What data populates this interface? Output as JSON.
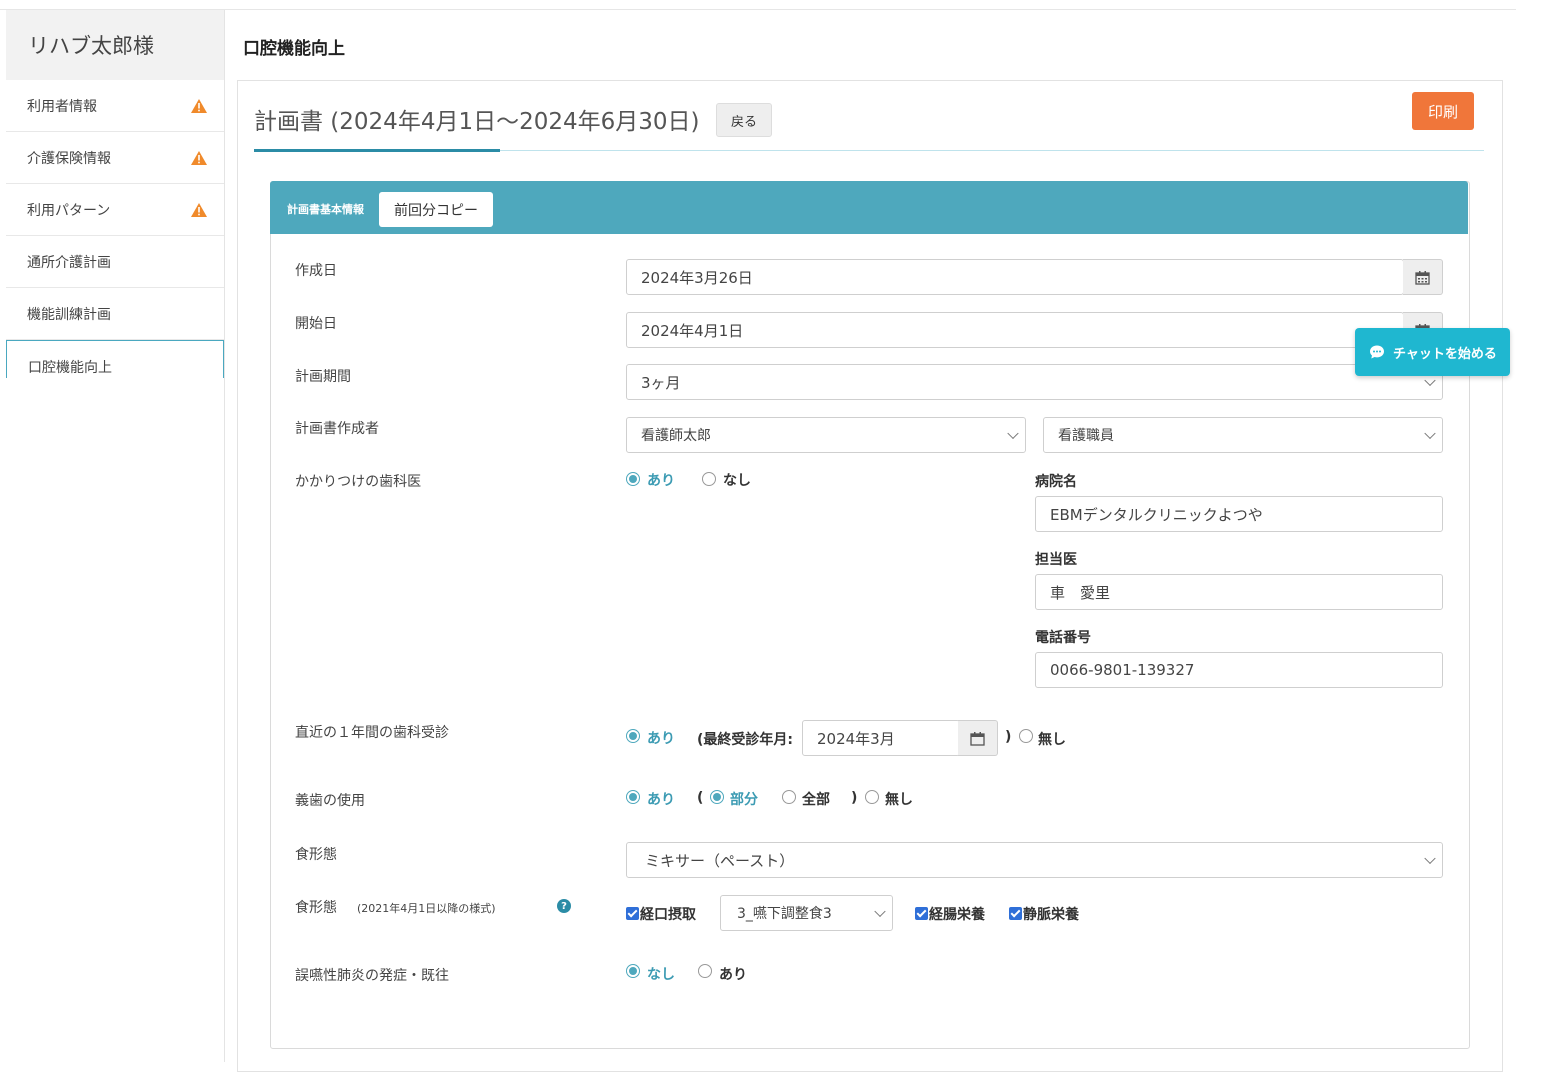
{
  "sidebar": {
    "title": "リハブ太郎様",
    "items": [
      {
        "label": "利用者情報",
        "warn": true
      },
      {
        "label": "介護保険情報",
        "warn": true
      },
      {
        "label": "利用パターン",
        "warn": true
      },
      {
        "label": "通所介護計画",
        "warn": false
      },
      {
        "label": "機能訓練計画",
        "warn": false
      },
      {
        "label": "口腔機能向上",
        "warn": false
      }
    ]
  },
  "page": {
    "title": "口腔機能向上"
  },
  "plan": {
    "title": "計画書 (2024年4月1日〜2024年6月30日)",
    "back_label": "戻る",
    "print_label": "印刷"
  },
  "panel": {
    "header_label": "計画書基本情報",
    "copy_label": "前回分コピー"
  },
  "form": {
    "created_date": {
      "label": "作成日",
      "value": "2024年3月26日"
    },
    "start_date": {
      "label": "開始日",
      "value": "2024年4月1日"
    },
    "period": {
      "label": "計画期間",
      "value": "3ヶ月"
    },
    "author": {
      "label": "計画書作成者",
      "name": "看護師太郎",
      "role": "看護職員"
    },
    "dentist": {
      "label": "かかりつけの歯科医",
      "yes": "あり",
      "no": "なし",
      "hospital_label": "病院名",
      "hospital": "EBMデンタルクリニックよつや",
      "doctor_label": "担当医",
      "doctor": "車　愛里",
      "phone_label": "電話番号",
      "phone": "0066-9801-139327"
    },
    "recent_visit": {
      "label": "直近の１年間の歯科受診",
      "yes": "あり",
      "last_label": "(最終受診年月:",
      "last_value": "2024年3月",
      "close": ")",
      "no": "無し"
    },
    "denture": {
      "label": "義歯の使用",
      "yes": "あり",
      "open": "(",
      "partial": "部分",
      "full": "全部",
      "close": ")",
      "no": "無し"
    },
    "diet": {
      "label": "食形態",
      "value": "ミキサー（ペースト）"
    },
    "diet2": {
      "label": "食形態",
      "note": "(2021年4月1日以降の様式)",
      "oral": "経口摂取",
      "oral_select": "3_嚥下調整食3",
      "enteral": "経腸栄養",
      "iv": "静脈栄養"
    },
    "pneumonia": {
      "label": "誤嚥性肺炎の発症・既往",
      "no": "なし",
      "yes": "あり"
    }
  },
  "chat": {
    "label": "チャットを始める"
  },
  "colors": {
    "accent": "#4ea8bd",
    "print": "#f0763a",
    "chat": "#1fb7d0",
    "warning": "#f08a2b"
  }
}
